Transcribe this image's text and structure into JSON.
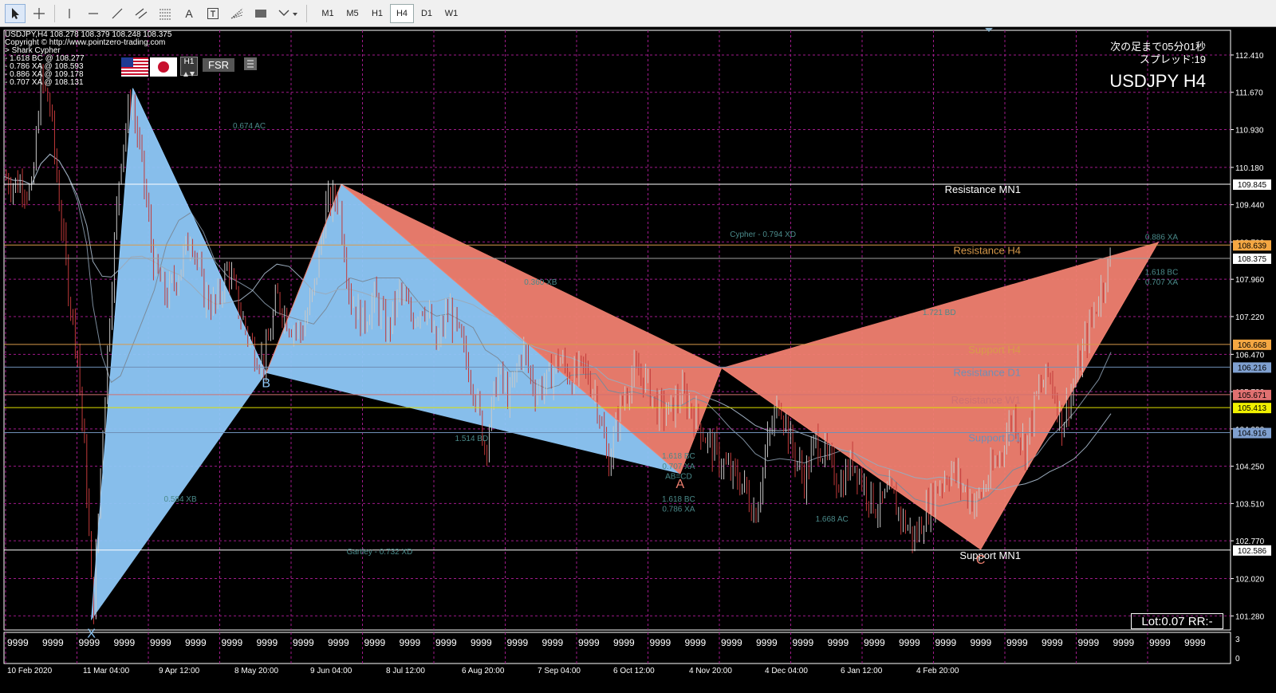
{
  "toolbar": {
    "tools": [
      {
        "name": "cursor-tool",
        "icon": "arrow-pointer-icon"
      },
      {
        "name": "crosshair-tool",
        "icon": "crosshair-icon"
      },
      {
        "name": "vertical-line-tool",
        "icon": "vertical-line-icon"
      },
      {
        "name": "horizontal-line-tool",
        "icon": "horizontal-line-icon"
      },
      {
        "name": "trendline-tool",
        "icon": "trendline-icon"
      },
      {
        "name": "equidistant-channel-tool",
        "icon": "channel-icon"
      },
      {
        "name": "fibonacci-tool",
        "icon": "fibonacci-icon"
      },
      {
        "name": "text-tool",
        "icon": "text-icon",
        "label": "A"
      },
      {
        "name": "text-label-tool",
        "icon": "text-label-icon"
      },
      {
        "name": "fibonacci-fan-tool",
        "icon": "fibonacci-fan-icon"
      },
      {
        "name": "rectangle-tool",
        "icon": "rectangle-icon"
      },
      {
        "name": "shapes-dropdown-tool",
        "icon": "shapes-dropdown-icon"
      }
    ],
    "timeframes": [
      "M1",
      "M5",
      "H1",
      "H4",
      "D1",
      "W1"
    ],
    "selected_timeframe": "H4"
  },
  "chart_info": {
    "header": "USDJPY,H4  108.278 108.379 108.248 108.375",
    "copyright": "Copyright © http://www.pointzero-trading.com",
    "pattern_lines": [
      "> Shark Cypher",
      "- 1.618 BC @ 108.277",
      "- 0.786 XA @ 108.593",
      "- 0.886 XA @ 109.178",
      "- 0.707 XA @ 108.131"
    ],
    "next_bar": "次の足まで05分01秒",
    "spread": "スプレッド:19",
    "symbol_title": "USDJPY H4",
    "fsr_button": "FSR",
    "h1_badge": "H1",
    "lot_box": "Lot:0.07 RR:-",
    "flags": [
      "us-flag-icon",
      "japan-flag-icon"
    ]
  },
  "levels": [
    {
      "name": "Resistance MN1",
      "price": 109.845,
      "box": "109.845",
      "color": "#ffffff",
      "boxbg": "#ffffff",
      "boxfg": "#000000"
    },
    {
      "name": "Resistance H4",
      "price": 108.639,
      "box": "108.639",
      "color": "#d89a4a",
      "boxbg": "#f4a742",
      "boxfg": "#000000"
    },
    {
      "name": "",
      "price": 108.375,
      "box": "108.375",
      "color": "#a0a0a0",
      "boxbg": "#ffffff",
      "boxfg": "#000000"
    },
    {
      "name": "Support H4",
      "price": 106.668,
      "box": "106.668",
      "color": "#d89a4a",
      "boxbg": "#f4a742",
      "boxfg": "#000000"
    },
    {
      "name": "Resistance D1",
      "price": 106.216,
      "box": "106.216",
      "color": "#6f8fb6",
      "boxbg": "#7fa0d0",
      "boxfg": "#000000"
    },
    {
      "name": "Resistance W1",
      "price": 105.671,
      "box": "105.671",
      "color": "#d07070",
      "boxbg": "#e07070",
      "boxfg": "#000000"
    },
    {
      "name": "",
      "price": 105.413,
      "box": "105.413",
      "color": "#e0e000",
      "boxbg": "#f0f000",
      "boxfg": "#000000"
    },
    {
      "name": "Support D1",
      "price": 104.916,
      "box": "104.916",
      "color": "#6f8fb6",
      "boxbg": "#7fa0d0",
      "boxfg": "#000000"
    },
    {
      "name": "Support MN1",
      "price": 102.586,
      "box": "102.586",
      "color": "#ffffff",
      "boxbg": "#ffffff",
      "boxfg": "#000000"
    }
  ],
  "chart_data": {
    "type": "candlestick",
    "symbol": "USDJPY",
    "timeframe": "H4",
    "ylim": [
      101.0,
      112.9
    ],
    "y_ticks": [
      "112.410",
      "111.670",
      "110.930",
      "110.180",
      "109.440",
      "108.700",
      "107.960",
      "107.220",
      "106.470",
      "105.730",
      "104.990",
      "104.250",
      "103.510",
      "102.770",
      "102.020",
      "101.280"
    ],
    "x_ticks": [
      "10 Feb 2020",
      "11 Mar 04:00",
      "9 Apr 12:00",
      "8 May 20:00",
      "9 Jun 04:00",
      "8 Jul 12:00",
      "6 Aug 20:00",
      "7 Sep 04:00",
      "6 Oct 12:00",
      "4 Nov 20:00",
      "4 Dec 04:00",
      "6 Jan 12:00",
      "4 Feb 20:00"
    ],
    "price_path": [
      {
        "t": 0.0,
        "p": 110.0
      },
      {
        "t": 0.6,
        "p": 109.85
      },
      {
        "t": 1.2,
        "p": 109.9
      },
      {
        "t": 1.8,
        "p": 109.6
      },
      {
        "t": 2.4,
        "p": 111.9
      },
      {
        "t": 3.0,
        "p": 111.4
      },
      {
        "t": 3.6,
        "p": 109.5
      },
      {
        "t": 4.2,
        "p": 107.8
      },
      {
        "t": 4.8,
        "p": 106.5
      },
      {
        "t": 5.4,
        "p": 103.8
      },
      {
        "t": 5.8,
        "p": 101.2
      },
      {
        "t": 6.4,
        "p": 104.8
      },
      {
        "t": 7.0,
        "p": 107.8
      },
      {
        "t": 7.6,
        "p": 110.4
      },
      {
        "t": 8.3,
        "p": 111.6
      },
      {
        "t": 9.0,
        "p": 110.2
      },
      {
        "t": 9.8,
        "p": 108.2
      },
      {
        "t": 10.6,
        "p": 107.6
      },
      {
        "t": 11.4,
        "p": 108.1
      },
      {
        "t": 12.2,
        "p": 108.9
      },
      {
        "t": 13.0,
        "p": 107.7
      },
      {
        "t": 13.8,
        "p": 107.4
      },
      {
        "t": 14.6,
        "p": 108.2
      },
      {
        "t": 15.4,
        "p": 107.3
      },
      {
        "t": 16.2,
        "p": 106.6
      },
      {
        "t": 17.0,
        "p": 106.3
      },
      {
        "t": 17.8,
        "p": 107.6
      },
      {
        "t": 18.6,
        "p": 107.1
      },
      {
        "t": 19.4,
        "p": 106.9
      },
      {
        "t": 20.2,
        "p": 107.7
      },
      {
        "t": 21.0,
        "p": 109.4
      },
      {
        "t": 21.8,
        "p": 109.6
      },
      {
        "t": 22.6,
        "p": 107.6
      },
      {
        "t": 23.4,
        "p": 107.1
      },
      {
        "t": 24.2,
        "p": 107.6
      },
      {
        "t": 25.0,
        "p": 106.9
      },
      {
        "t": 25.8,
        "p": 107.7
      },
      {
        "t": 26.6,
        "p": 107.2
      },
      {
        "t": 27.4,
        "p": 107.5
      },
      {
        "t": 28.2,
        "p": 106.6
      },
      {
        "t": 29.0,
        "p": 107.4
      },
      {
        "t": 29.8,
        "p": 106.7
      },
      {
        "t": 30.6,
        "p": 105.9
      },
      {
        "t": 31.4,
        "p": 104.6
      },
      {
        "t": 32.2,
        "p": 106.1
      },
      {
        "t": 33.0,
        "p": 105.6
      },
      {
        "t": 33.8,
        "p": 106.6
      },
      {
        "t": 34.6,
        "p": 105.8
      },
      {
        "t": 35.4,
        "p": 105.9
      },
      {
        "t": 36.2,
        "p": 106.4
      },
      {
        "t": 37.0,
        "p": 106.0
      },
      {
        "t": 37.8,
        "p": 106.2
      },
      {
        "t": 38.6,
        "p": 105.7
      },
      {
        "t": 39.4,
        "p": 104.3
      },
      {
        "t": 40.2,
        "p": 105.4
      },
      {
        "t": 41.0,
        "p": 106.1
      },
      {
        "t": 41.8,
        "p": 106.0
      },
      {
        "t": 42.6,
        "p": 105.4
      },
      {
        "t": 43.4,
        "p": 105.3
      },
      {
        "t": 44.2,
        "p": 105.7
      },
      {
        "t": 45.0,
        "p": 105.3
      },
      {
        "t": 45.8,
        "p": 104.8
      },
      {
        "t": 46.6,
        "p": 104.4
      },
      {
        "t": 47.4,
        "p": 104.1
      },
      {
        "t": 48.2,
        "p": 103.9
      },
      {
        "t": 49.0,
        "p": 103.3
      },
      {
        "t": 49.8,
        "p": 104.7
      },
      {
        "t": 50.6,
        "p": 105.6
      },
      {
        "t": 51.4,
        "p": 104.6
      },
      {
        "t": 52.2,
        "p": 104.0
      },
      {
        "t": 53.0,
        "p": 104.8
      },
      {
        "t": 53.8,
        "p": 104.3
      },
      {
        "t": 54.6,
        "p": 103.9
      },
      {
        "t": 55.4,
        "p": 104.4
      },
      {
        "t": 56.2,
        "p": 103.8
      },
      {
        "t": 57.0,
        "p": 103.4
      },
      {
        "t": 57.8,
        "p": 103.7
      },
      {
        "t": 58.6,
        "p": 103.2
      },
      {
        "t": 59.4,
        "p": 102.8
      },
      {
        "t": 60.2,
        "p": 103.4
      },
      {
        "t": 61.0,
        "p": 103.9
      },
      {
        "t": 61.8,
        "p": 104.2
      },
      {
        "t": 62.6,
        "p": 103.8
      },
      {
        "t": 63.4,
        "p": 103.5
      },
      {
        "t": 64.2,
        "p": 104.0
      },
      {
        "t": 65.0,
        "p": 104.5
      },
      {
        "t": 65.8,
        "p": 105.3
      },
      {
        "t": 66.6,
        "p": 104.6
      },
      {
        "t": 67.4,
        "p": 105.7
      },
      {
        "t": 68.2,
        "p": 106.1
      },
      {
        "t": 69.0,
        "p": 105.1
      },
      {
        "t": 69.8,
        "p": 105.9
      },
      {
        "t": 70.6,
        "p": 106.8
      },
      {
        "t": 71.4,
        "p": 107.6
      },
      {
        "t": 72.2,
        "p": 108.4
      }
    ],
    "pattern_points": [
      {
        "label": "X",
        "t": 5.7,
        "p": 101.2,
        "color": "#8ec8f8"
      },
      {
        "label": "",
        "t": 8.4,
        "p": 111.75,
        "color": "#8ec8f8"
      },
      {
        "label": "B",
        "t": 17.1,
        "p": 106.1,
        "color": "#8ec8f8"
      },
      {
        "label": "",
        "t": 22.0,
        "p": 109.85,
        "color": "#f08070"
      },
      {
        "label": "A",
        "t": 44.1,
        "p": 104.1,
        "color": "#f08070"
      },
      {
        "label": "",
        "t": 46.8,
        "p": 106.2,
        "color": "#f08070"
      },
      {
        "label": "C",
        "t": 63.7,
        "p": 102.6,
        "color": "#f08070"
      },
      {
        "label": "",
        "t": 75.3,
        "p": 108.7,
        "color": "#f08070"
      }
    ],
    "annotations": [
      {
        "text": "0.674 AC",
        "t": 16.0,
        "p": 110.95,
        "color": "#4a8a8a"
      },
      {
        "text": "Cypher - 0.794 XD",
        "t": 49.5,
        "p": 108.8,
        "color": "#4a8a8a"
      },
      {
        "text": "0.360 XB",
        "t": 35.0,
        "p": 107.85,
        "color": "#4a8a8a"
      },
      {
        "text": "0.886 XA",
        "t": 75.5,
        "p": 108.75,
        "color": "#4a8a8a"
      },
      {
        "text": "1.618 BC",
        "t": 75.5,
        "p": 108.05,
        "color": "#4a8a8a"
      },
      {
        "text": "0.707 XA",
        "t": 75.5,
        "p": 107.85,
        "color": "#4a8a8a"
      },
      {
        "text": "1.721 BD",
        "t": 61.0,
        "p": 107.25,
        "color": "#4a8a8a"
      },
      {
        "text": "1.514 BD",
        "t": 30.5,
        "p": 104.75,
        "color": "#4a8a8a"
      },
      {
        "text": "1.618 BC",
        "t": 44.0,
        "p": 104.4,
        "color": "#4a8a8a"
      },
      {
        "text": "0.707 XA",
        "t": 44.0,
        "p": 104.2,
        "color": "#4a8a8a"
      },
      {
        "text": "AB=CD",
        "t": 44.0,
        "p": 104.0,
        "color": "#4a8a8a"
      },
      {
        "text": "0.584 XB",
        "t": 11.5,
        "p": 103.55,
        "color": "#4a8a8a"
      },
      {
        "text": "1.618 BC",
        "t": 44.0,
        "p": 103.55,
        "color": "#4a8a8a"
      },
      {
        "text": "0.786 XA",
        "t": 44.0,
        "p": 103.35,
        "color": "#4a8a8a"
      },
      {
        "text": "1.668 AC",
        "t": 54.0,
        "p": 103.15,
        "color": "#4a8a8a"
      },
      {
        "text": "Gartley - 0.732 XD",
        "t": 24.5,
        "p": 102.5,
        "color": "#4a8a8a"
      }
    ],
    "subwindow": {
      "values_text": "9999",
      "ticks": [
        "3",
        "0"
      ]
    }
  }
}
